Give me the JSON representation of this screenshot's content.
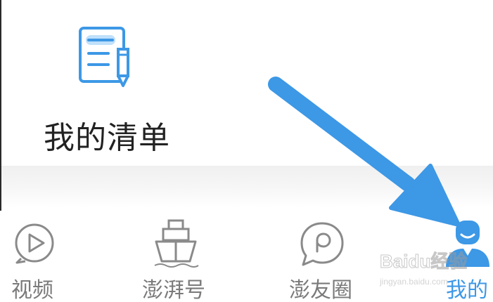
{
  "checklist": {
    "label": "我的清单",
    "icon": "checklist-pencil-icon",
    "icon_color": "#3d98e6"
  },
  "tabbar": {
    "tabs": [
      {
        "label": "视频",
        "icon": "play-circle-icon",
        "active": false
      },
      {
        "label": "澎湃号",
        "icon": "ship-icon",
        "active": false
      },
      {
        "label": "澎友圈",
        "icon": "chat-bubble-icon",
        "active": false
      },
      {
        "label": "我的",
        "icon": "user-avatar-icon",
        "active": true
      }
    ],
    "inactive_color": "#7a7a7a",
    "active_color": "#3d98e6"
  },
  "annotation": {
    "arrow_color": "#3d98e6"
  },
  "watermark": {
    "brand": "Baidu经验",
    "url": "jingyan.baidu.com"
  }
}
